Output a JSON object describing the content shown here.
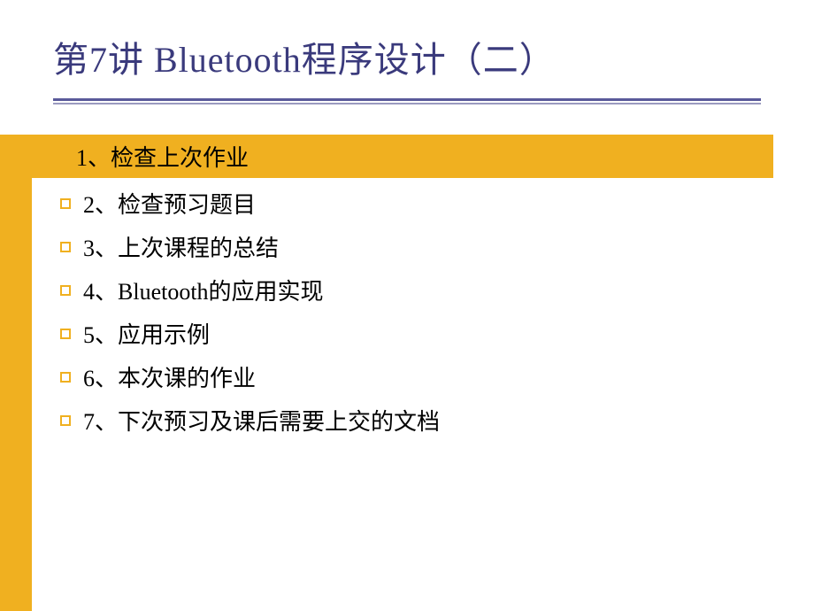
{
  "title": "第7讲 Bluetooth程序设计（二）",
  "highlighted_item": "1、检查上次作业",
  "items": [
    "2、检查预习题目",
    "3、上次课程的总结",
    "4、Bluetooth的应用实现",
    "5、应用示例",
    "6、本次课的作业",
    "7、下次预习及课后需要上交的文档"
  ]
}
